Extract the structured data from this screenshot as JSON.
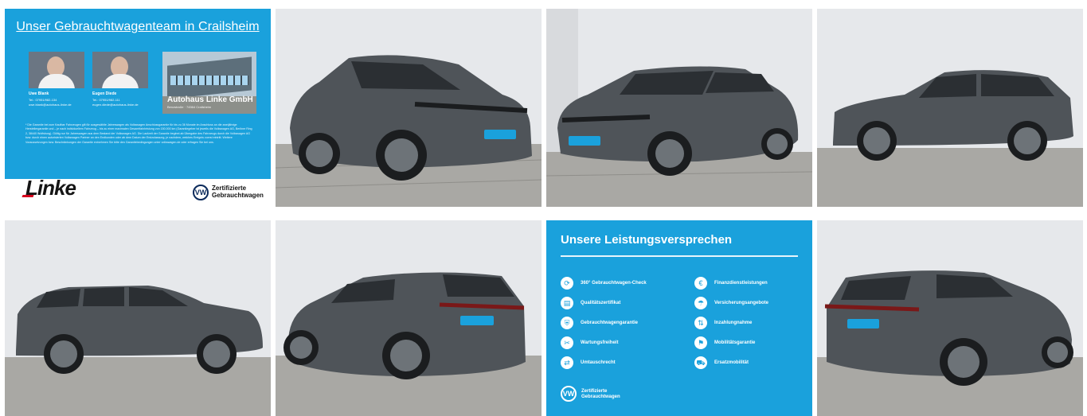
{
  "colors": {
    "brand_blue": "#1aa1dc",
    "car_gray": "#4f5459",
    "wall": "#e6e8eb",
    "pavement": "#a9a8a4",
    "logo_red": "#d6001c",
    "vw_navy": "#0b2a5b"
  },
  "team_tile": {
    "title": "Unser Gebrauchtwagenteam in Crailsheim",
    "people": [
      {
        "name": "Uwe Blank",
        "contact": "Tel.: 07951/982-134\nuwe.blank@autohaus-linke.de"
      },
      {
        "name": "Eugen Diede",
        "contact": "Tel.: 07951/982-111\neugen.diede@autohaus-linke.de"
      }
    ],
    "dealer_name": "Autohaus Linke GmbH",
    "dealer_sub": "Benzstraße · 74564 Crailsheim",
    "disclaimer": "* Die Garantie bei zum Kaufbar Fahrzeugen gilt für ausgewählte Jahreswagen als Volkswagen Anschlussgarantie für bis zu 36 Monate im Anschluss an die zweijährige Herstellergarantie und – je nach individuellem Fahrzeug – bis zu einer maximalen Gesamtfahrleistung von 150.000 km (Garantiegeber ist jeweils die Volkswagen AG, Berliner Ring 2, 38440 Wolfsburg). Gültig nur für Jahreswagen aus dem Bestand der Volkswagen AG. Die Laufzeit der Garantie beginnt ab Übergabe des Fahrzeugs durch die Volkswagen AG bzw. durch einen autorisierten Volkswagen Partner an den Endkunden oder ab dem Datum der Erstzulassung, je nachdem, welches Ereignis zuerst eintritt. Weitere Voraussetzungen bzw. Beschränkungen der Garantie entnehmen Sie bitte den Garantiebedingungen unter volkswagen.de oder erfragen Sie bei uns.",
    "logo_text": "Linke",
    "vw_mark": "VW",
    "vw_text_line1": "Zertifizierte",
    "vw_text_line2": "Gebrauchtwagen"
  },
  "photos": [
    {
      "icon": "car-photo-front-three-quarter-right-icon"
    },
    {
      "icon": "car-photo-front-three-quarter-left-icon"
    },
    {
      "icon": "car-photo-side-left-icon"
    },
    {
      "icon": "car-photo-side-left-icon"
    },
    {
      "icon": "car-photo-rear-three-quarter-left-icon"
    },
    {
      "icon": "car-photo-rear-three-quarter-right-icon"
    }
  ],
  "promise_tile": {
    "title": "Unsere Leistungsversprechen",
    "left_items": [
      "360° Gebrauchtwagen-Check",
      "Qualitätszertifikat",
      "Gebrauchtwagengarantie",
      "Wartungsfreiheit",
      "Umtauschrecht"
    ],
    "right_items": [
      "Finanzdienstleistungen",
      "Versicherungsangebote",
      "Inzahlungnahme",
      "Mobilitätsgarantie",
      "Ersatzmobilität"
    ],
    "vw_mark": "VW",
    "vw_label_line1": "Zertifizierte",
    "vw_label_line2": "Gebrauchtwagen"
  }
}
